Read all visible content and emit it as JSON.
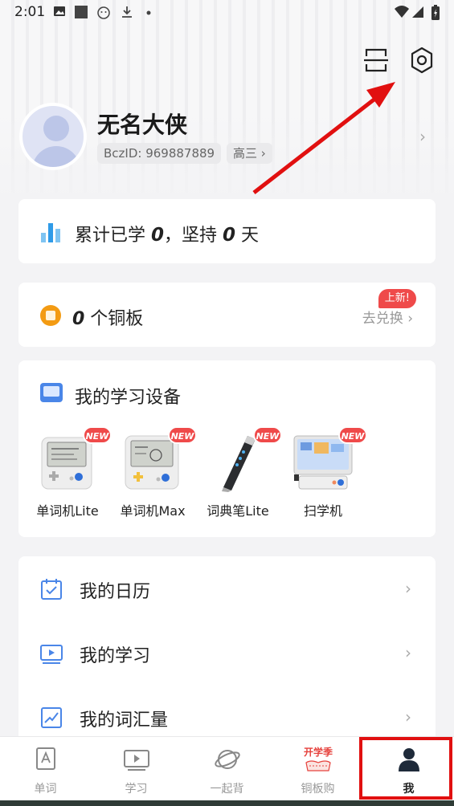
{
  "status_bar": {
    "time": "2:01"
  },
  "profile": {
    "name": "无名大侠",
    "id_chip": "BczID: 969887889",
    "grade_chip": "高三 ›",
    "chevron": "›"
  },
  "stats": {
    "prefix": "累计已学 ",
    "learned_count": "0",
    "middle": "，坚持 ",
    "days": "0",
    "suffix": " 天"
  },
  "coins": {
    "count": "0",
    "unit": " 个铜板",
    "exchange_label": "去兑换 ›",
    "new_badge": "上新!"
  },
  "devices": {
    "title": "我的学习设备",
    "new_label": "NEW",
    "items": [
      {
        "label": "单词机Lite"
      },
      {
        "label": "单词机Max"
      },
      {
        "label": "词典笔Lite"
      },
      {
        "label": "扫学机"
      }
    ]
  },
  "menu": {
    "chevron": "›",
    "items": [
      {
        "label": "我的日历",
        "icon": "calendar-icon"
      },
      {
        "label": "我的学习",
        "icon": "play-screen-icon"
      },
      {
        "label": "我的词汇量",
        "icon": "chart-icon"
      }
    ]
  },
  "bottom_nav": {
    "items": [
      {
        "label": "单词",
        "icon": "word-card-icon"
      },
      {
        "label": "学习",
        "icon": "video-icon"
      },
      {
        "label": "一起背",
        "icon": "planet-icon"
      },
      {
        "label": "铜板购",
        "icon": "school-season-icon",
        "badge_text": "开学季"
      },
      {
        "label": "我",
        "icon": "user-icon",
        "active": true
      }
    ]
  },
  "colors": {
    "accent_blue": "#4a86e8",
    "coin_orange": "#f39b13",
    "badge_red": "#ef4a4a",
    "highlight_red": "#e11010"
  }
}
